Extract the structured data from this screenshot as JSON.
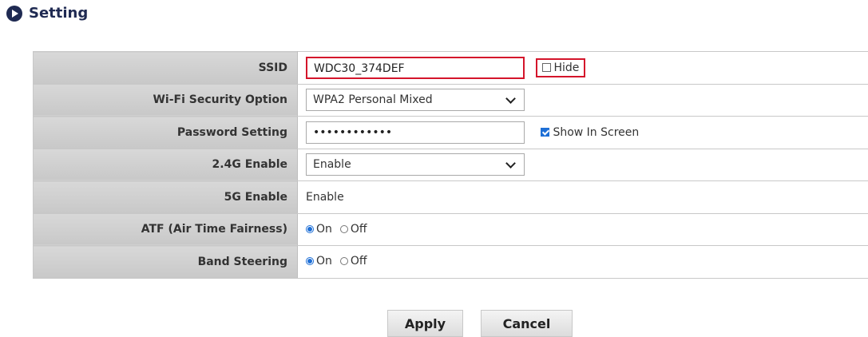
{
  "header": {
    "title": "Setting",
    "icon": "play-circle-icon"
  },
  "rows": {
    "ssid": {
      "label": "SSID",
      "value": "WDC30_374DEF",
      "hide_label": "Hide",
      "hide_checked": false
    },
    "security": {
      "label": "Wi-Fi Security Option",
      "selected": "WPA2 Personal Mixed"
    },
    "password": {
      "label": "Password Setting",
      "value": "••••••••••••",
      "show_label": "Show In Screen",
      "show_checked": true
    },
    "g24": {
      "label": "2.4G Enable",
      "selected": "Enable"
    },
    "g5": {
      "label": "5G Enable",
      "value": "Enable"
    },
    "atf": {
      "label": "ATF (Air Time Fairness)",
      "on_label": "On",
      "off_label": "Off",
      "selected": "On"
    },
    "band": {
      "label": "Band Steering",
      "on_label": "On",
      "off_label": "Off",
      "selected": "On"
    }
  },
  "buttons": {
    "apply": "Apply",
    "cancel": "Cancel"
  },
  "colors": {
    "highlight": "#d4152b",
    "accent": "#1e6fd6",
    "header": "#1f2a52"
  }
}
